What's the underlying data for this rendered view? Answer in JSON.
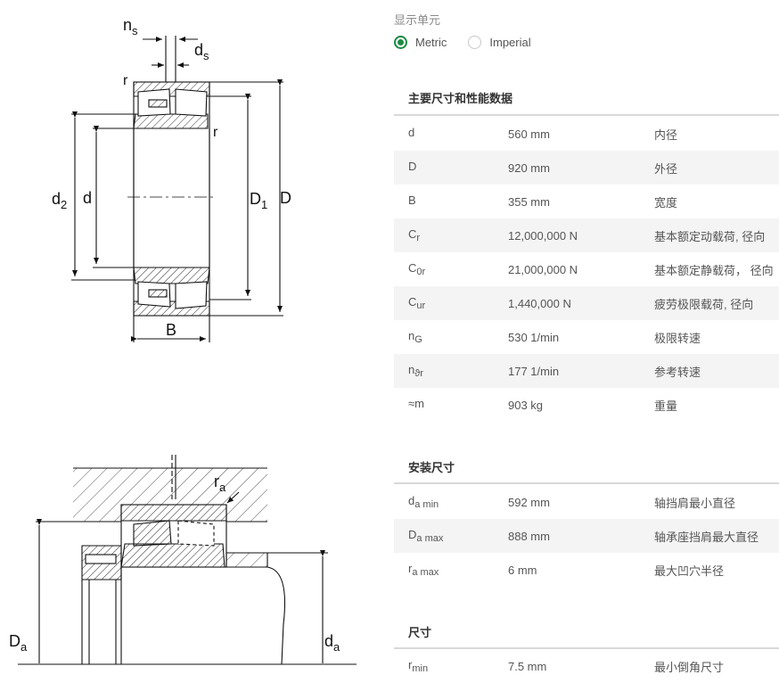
{
  "units": {
    "label": "显示单元",
    "options": [
      {
        "label": "Metric",
        "selected": true
      },
      {
        "label": "Imperial",
        "selected": false
      }
    ]
  },
  "sections": [
    {
      "title": "主要尺寸和性能数据",
      "rows": [
        {
          "sym": "d",
          "sub": "",
          "value": "560 mm",
          "desc": "内径"
        },
        {
          "sym": "D",
          "sub": "",
          "value": "920 mm",
          "desc": "外径"
        },
        {
          "sym": "B",
          "sub": "",
          "value": "355 mm",
          "desc": "宽度"
        },
        {
          "sym": "C",
          "sub": "r",
          "value": "12,000,000 N",
          "desc": "基本额定动载荷, 径向"
        },
        {
          "sym": "C",
          "sub": "0r",
          "value": "21,000,000 N",
          "desc": "基本额定静载荷， 径向"
        },
        {
          "sym": "C",
          "sub": "ur",
          "value": "1,440,000 N",
          "desc": "疲劳极限载荷, 径向"
        },
        {
          "sym": "n",
          "sub": "G",
          "value": "530 1/min",
          "desc": "极限转速"
        },
        {
          "sym": "n",
          "sub": "ϑr",
          "value": "177 1/min",
          "desc": "参考转速"
        },
        {
          "sym": "≈m",
          "sub": "",
          "value": "903 kg",
          "desc": "重量"
        }
      ]
    },
    {
      "title": "安装尺寸",
      "rows": [
        {
          "sym": "d",
          "sub": "a min",
          "value": "592 mm",
          "desc": "轴挡肩最小直径"
        },
        {
          "sym": "D",
          "sub": "a max",
          "value": "888 mm",
          "desc": "轴承座挡肩最大直径"
        },
        {
          "sym": "r",
          "sub": "a max",
          "value": "6 mm",
          "desc": "最大凹穴半径"
        }
      ]
    },
    {
      "title": "尺寸",
      "rows": [
        {
          "sym": "r",
          "sub": "min",
          "value": "7.5 mm",
          "desc": "最小倒角尺寸"
        }
      ]
    }
  ],
  "drawing_labels": {
    "top": {
      "ns": "n",
      "ns_sub": "s",
      "ds": "d",
      "ds_sub": "s",
      "r_top": "r",
      "r_right": "r",
      "d2": "d",
      "d2_sub": "2",
      "d": "d",
      "D1": "D",
      "D1_sub": "1",
      "D": "D",
      "B": "B"
    },
    "bottom": {
      "ra": "r",
      "ra_sub": "a",
      "Da": "D",
      "Da_sub": "a",
      "da": "d",
      "da_sub": "a"
    }
  }
}
